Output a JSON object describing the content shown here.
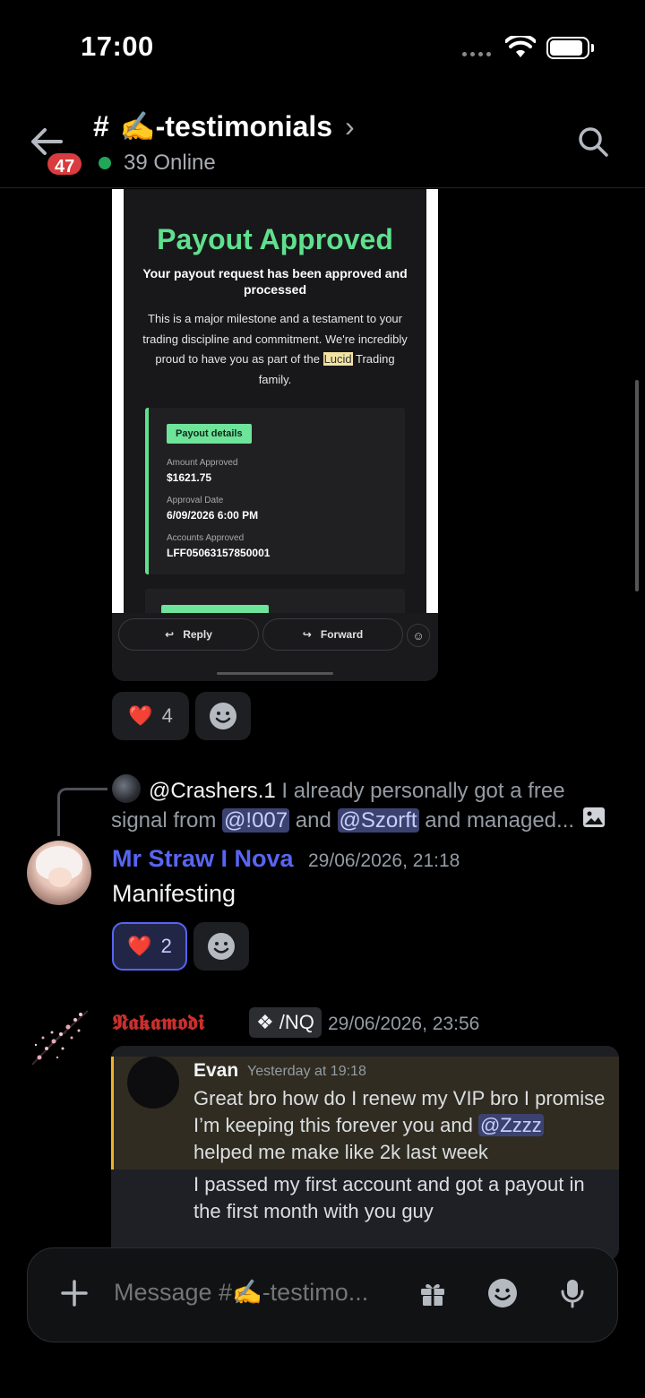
{
  "status_bar": {
    "time": "17:00"
  },
  "header": {
    "unread_count": "47",
    "hash": "#",
    "channel_name": "✍️-testimonials",
    "chevron": "›",
    "online_count": "39 Online"
  },
  "email_image": {
    "title": "Payout Approved",
    "subtitle": "Your payout request has been approved and processed",
    "body_before": "This is a major milestone and a testament to your trading discipline and commitment. We're incredibly proud to have you as part of the ",
    "body_highlight": "Lucid",
    "body_after": " Trading family.",
    "details_pill": "Payout details",
    "amount_label": "Amount Approved",
    "amount_value": "$1621.75",
    "date_label": "Approval Date",
    "date_value": "6/09/2026 6:00 PM",
    "accounts_label": "Accounts Approved",
    "accounts_value": "LFF05063157850001",
    "reply_label": "Reply",
    "forward_label": "Forward"
  },
  "reactions_1": {
    "emoji": "❤️",
    "count": "4"
  },
  "reply_reference": {
    "user": "@Crashers.1",
    "text_1": " I already personally got a free signal from ",
    "mention_1": "@!007",
    "text_2": " and ",
    "mention_2": "@Szorft",
    "text_3": " and managed..."
  },
  "message_1": {
    "author": "Mr Straw I Nova",
    "author_color": "#5865f2",
    "timestamp": "29/06/2026, 21:18",
    "content": "Manifesting"
  },
  "reactions_2": {
    "emoji": "❤️",
    "count": "2"
  },
  "message_2": {
    "author": "𝕹𝖆𝖐𝖆𝖒𝖔𝖉𝖎",
    "author_color": "#c9302c",
    "tag_icon": "❖",
    "tag": "/NQ",
    "timestamp": "29/06/2026, 23:56"
  },
  "forwarded": {
    "author": "Evan",
    "time": "Yesterday at 19:18",
    "text_1": "Great bro how do I renew my VIP bro I promise I’m keeping this forever you and ",
    "mention": "@Zzzz",
    "text_2": " helped me make like 2k last week",
    "continuation": "I passed my first account and got a payout in the first month with you guy"
  },
  "composer": {
    "placeholder": "Message #✍️-testimo..."
  },
  "colors": {
    "background": "#000000",
    "accent": "#5865f2",
    "online": "#23a55a",
    "badge": "#d83c3e",
    "payout_green": "#5fe08e"
  }
}
